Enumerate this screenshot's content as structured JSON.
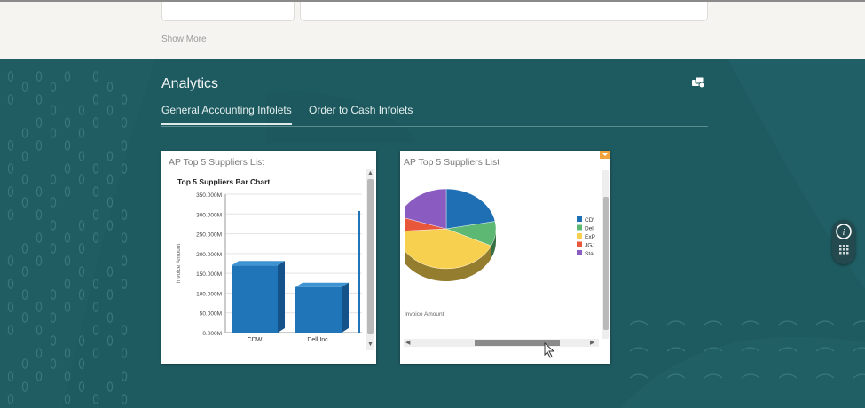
{
  "top_section": {
    "show_more": "Show More"
  },
  "analytics": {
    "title": "Analytics",
    "tabs": [
      {
        "label": "General Accounting Infolets",
        "active": true
      },
      {
        "label": "Order to Cash Infolets",
        "active": false
      }
    ]
  },
  "infolets": [
    {
      "title": "AP Top 5 Suppliers List",
      "chart_data": {
        "type": "bar",
        "title": "Top 5 Suppliers Bar Chart",
        "xlabel": "",
        "ylabel": "Invoice Amount",
        "categories": [
          "CDW",
          "Dell Inc."
        ],
        "values": [
          170,
          115
        ],
        "ylim": [
          0,
          350
        ],
        "ytick_labels": [
          "0.000M",
          "50.000M",
          "100.000M",
          "150.000M",
          "200.000M",
          "250.000M",
          "300.000M",
          "350.000M"
        ],
        "color": "#2074b8",
        "grid": true
      }
    },
    {
      "title": "AP Top 5 Suppliers List",
      "chart_data": {
        "type": "pie",
        "title": "",
        "label": "Invoice Amount",
        "legend_position": "right",
        "categories": [
          "CD\\",
          "Dell",
          "ExP",
          "JGJ",
          "Sta"
        ],
        "values": [
          22,
          10,
          42,
          6,
          20
        ],
        "colors": [
          "#1f6fb5",
          "#5cb872",
          "#f8d04f",
          "#e8573a",
          "#8a5cc2"
        ]
      }
    }
  ]
}
